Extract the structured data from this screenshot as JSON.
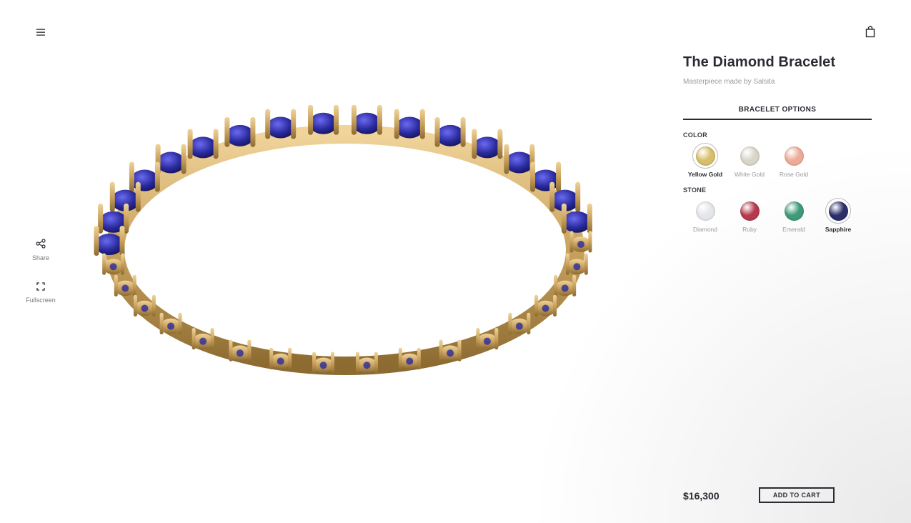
{
  "header": {
    "menu_icon": "hamburger-menu-icon",
    "cart_icon": "shopping-bag-icon"
  },
  "side_actions": {
    "share_label": "Share",
    "fullscreen_label": "Fullscreen"
  },
  "product": {
    "title": "The Diamond Bracelet",
    "subtitle": "Masterpiece made by Salsita",
    "tab_label": "BRACELET OPTIONS",
    "price": "$16,300",
    "add_to_cart_label": "ADD TO CART"
  },
  "options": {
    "color_label": "COLOR",
    "colors": [
      {
        "name": "Yellow Gold",
        "hex": "#d8bf6a",
        "selected": true
      },
      {
        "name": "White Gold",
        "hex": "#d9d6c8",
        "selected": false
      },
      {
        "name": "Rose Gold",
        "hex": "#eeab98",
        "selected": false
      }
    ],
    "stone_label": "STONE",
    "stones": [
      {
        "name": "Diamond",
        "hex": "#e4e6ea",
        "selected": false
      },
      {
        "name": "Ruby",
        "hex": "#b53a4e",
        "selected": false
      },
      {
        "name": "Emerald",
        "hex": "#3e9a78",
        "selected": false
      },
      {
        "name": "Sapphire",
        "hex": "#2a2f6b",
        "selected": true
      }
    ]
  },
  "colors": {
    "gold": "#c9a25e",
    "gold_dark": "#8c6a30",
    "sapphire": "#2a2a9e",
    "text_dark": "#2b2b33"
  }
}
